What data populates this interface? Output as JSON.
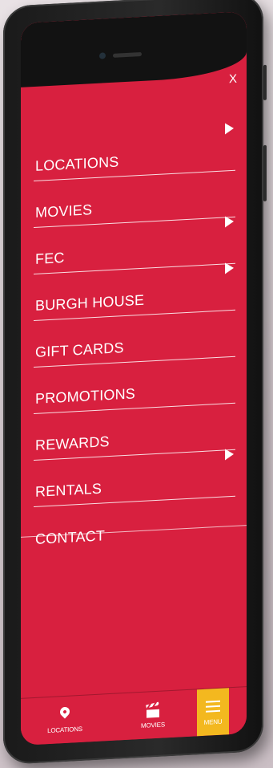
{
  "screen": {
    "close_label": "X"
  },
  "menu": {
    "items": [
      {
        "label": "LOCATIONS",
        "has_arrow": true
      },
      {
        "label": "MOVIES",
        "has_arrow": false
      },
      {
        "label": "FEC",
        "has_arrow": true
      },
      {
        "label": "BURGH HOUSE",
        "has_arrow": true
      },
      {
        "label": "GIFT CARDS",
        "has_arrow": false
      },
      {
        "label": "PROMOTIONS",
        "has_arrow": false
      },
      {
        "label": "REWARDS",
        "has_arrow": false
      },
      {
        "label": "RENTALS",
        "has_arrow": true
      },
      {
        "label": "CONTACT",
        "has_arrow": false
      }
    ]
  },
  "tabbar": {
    "locations_label": "LOCATIONS",
    "movies_label": "MOVIES",
    "menu_label": "MENU"
  },
  "colors": {
    "brand_red": "#d8203f",
    "menu_tab_yellow": "#f3b81f",
    "text": "#ffffff"
  },
  "icons": {
    "close": "close-icon",
    "arrow": "arrow-right-icon",
    "locations": "location-pin-icon",
    "movies": "clapperboard-icon",
    "menu": "hamburger-icon"
  }
}
